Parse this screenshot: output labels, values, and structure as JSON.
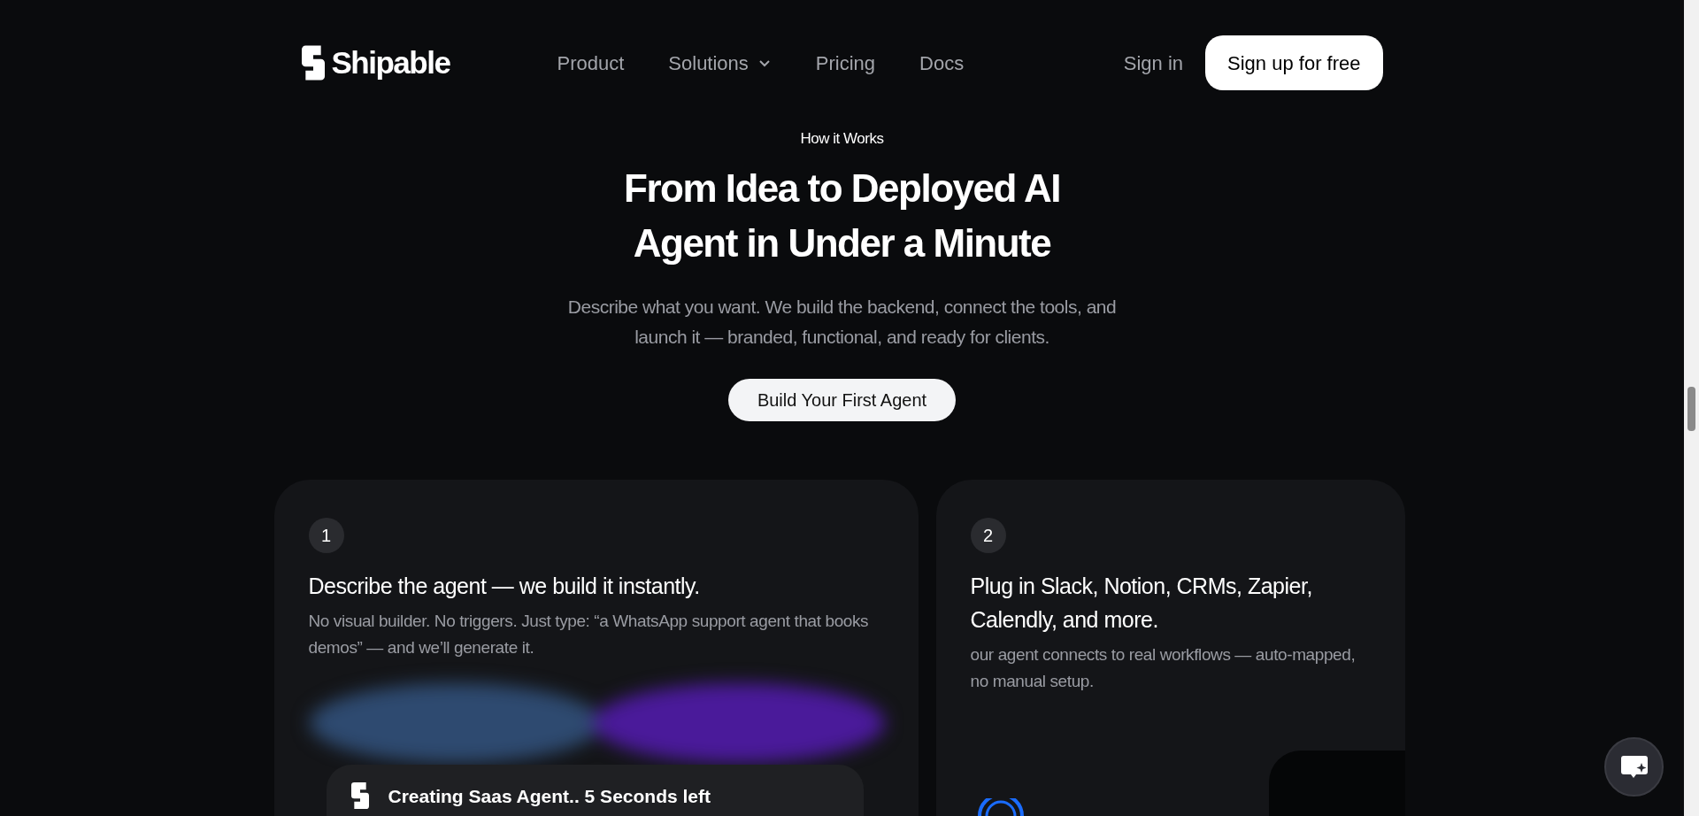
{
  "header": {
    "logo": "Shipable",
    "nav": [
      {
        "label": "Product",
        "dropdown": false
      },
      {
        "label": "Solutions",
        "dropdown": true
      },
      {
        "label": "Pricing",
        "dropdown": false
      },
      {
        "label": "Docs",
        "dropdown": false
      }
    ],
    "sign_in": "Sign in",
    "signup_button": "Sign up for free"
  },
  "hero": {
    "eyebrow": "How it Works",
    "title_lines": [
      "From Idea to Deployed AI",
      "Agent in Under a Minute"
    ],
    "subtitle_lines": [
      "Describe what you want. We build the backend, connect the tools, and",
      "launch it — branded, functional, and ready for clients."
    ],
    "cta": "Build Your First Agent"
  },
  "steps": [
    {
      "number": "1",
      "title": "Describe the agent — we build it instantly.",
      "description": "No visual builder. No triggers. Just type: “a WhatsApp support agent that books demos” — and we’ll generate it.",
      "kind": "builder",
      "status": "Creating Saas Agent.. 5 Seconds left"
    },
    {
      "number": "2",
      "title": "Plug in Slack, Notion, CRMs, Zapier, Calendly, and more.",
      "description": "our agent connects to real workflows — auto-mapped, no manual setup.",
      "kind": "integrations"
    }
  ]
}
